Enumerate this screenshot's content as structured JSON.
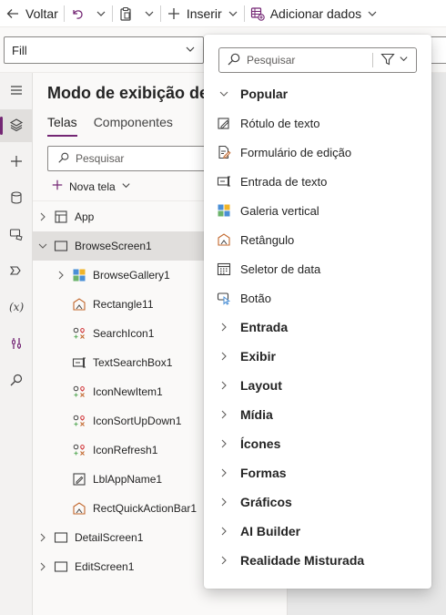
{
  "toolbar": {
    "back_label": "Voltar",
    "insert_label": "Inserir",
    "add_data_label": "Adicionar dados"
  },
  "property_select": {
    "value": "Fill"
  },
  "tree_view": {
    "title": "Modo de exibição de árvore",
    "tabs": [
      "Telas",
      "Componentes"
    ],
    "search_placeholder": "Pesquisar",
    "new_screen_label": "Nova tela",
    "items": [
      {
        "label": "App",
        "icon": "app-icon",
        "level": 0,
        "expandable": true,
        "expanded": false
      },
      {
        "label": "BrowseScreen1",
        "icon": "screen-icon",
        "level": 0,
        "expandable": true,
        "expanded": true,
        "selected": true
      },
      {
        "label": "BrowseGallery1",
        "icon": "gallery-icon",
        "level": 1,
        "expandable": true,
        "expanded": false
      },
      {
        "label": "Rectangle11",
        "icon": "rectangle-icon",
        "level": 1,
        "expandable": false
      },
      {
        "label": "SearchIcon1",
        "icon": "icon-control-icon",
        "level": 1,
        "expandable": false
      },
      {
        "label": "TextSearchBox1",
        "icon": "text-input-icon",
        "level": 1,
        "expandable": false
      },
      {
        "label": "IconNewItem1",
        "icon": "icon-control-icon",
        "level": 1,
        "expandable": false
      },
      {
        "label": "IconSortUpDown1",
        "icon": "icon-control-icon",
        "level": 1,
        "expandable": false
      },
      {
        "label": "IconRefresh1",
        "icon": "icon-control-icon",
        "level": 1,
        "expandable": false
      },
      {
        "label": "LblAppName1",
        "icon": "label-icon",
        "level": 1,
        "expandable": false
      },
      {
        "label": "RectQuickActionBar1",
        "icon": "rectangle-icon",
        "level": 1,
        "expandable": false
      },
      {
        "label": "DetailScreen1",
        "icon": "screen-icon",
        "level": 0,
        "expandable": true,
        "expanded": false
      },
      {
        "label": "EditScreen1",
        "icon": "screen-icon",
        "level": 0,
        "expandable": true,
        "expanded": false
      }
    ]
  },
  "insert_menu": {
    "search_placeholder": "Pesquisar",
    "popular_label": "Popular",
    "popular_items": [
      {
        "label": "Rótulo de texto",
        "icon": "text-label-icon"
      },
      {
        "label": "Formulário de edição",
        "icon": "edit-form-icon"
      },
      {
        "label": "Entrada de texto",
        "icon": "text-input-icon"
      },
      {
        "label": "Galeria vertical",
        "icon": "gallery-icon"
      },
      {
        "label": "Retângulo",
        "icon": "rectangle-icon"
      },
      {
        "label": "Seletor de data",
        "icon": "calendar-icon"
      },
      {
        "label": "Botão",
        "icon": "button-icon"
      }
    ],
    "categories": [
      "Entrada",
      "Exibir",
      "Layout",
      "Mídia",
      "Ícones",
      "Formas",
      "Gráficos",
      "AI Builder",
      "Realidade Misturada"
    ]
  },
  "colors": {
    "accent": "#742774",
    "tree_bg": "#faf9f8",
    "rail_bg": "#f3f2f1",
    "canvas_bg": "#e8e8e8",
    "selected_row": "#e1dfdd"
  }
}
